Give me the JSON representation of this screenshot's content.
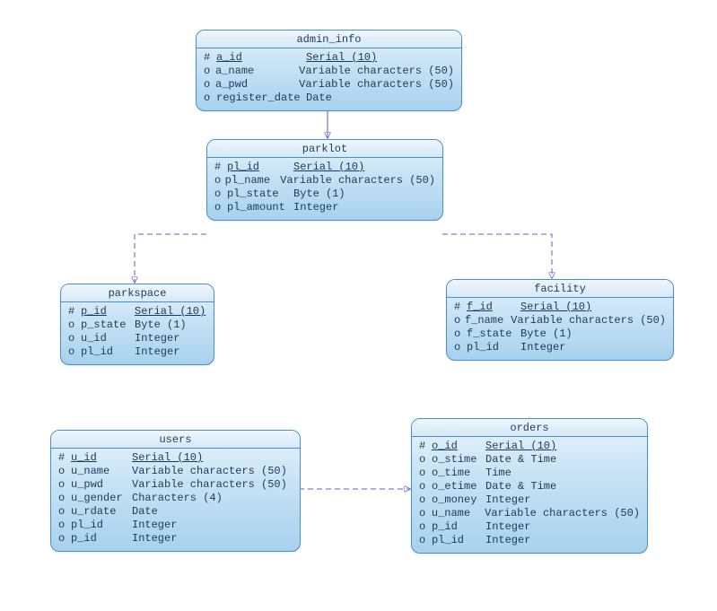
{
  "entities": {
    "admin_info": {
      "title": "admin_info",
      "fields": [
        {
          "sym": "#",
          "name": "a_id",
          "type": "Serial (10)",
          "pk": true
        },
        {
          "sym": "o",
          "name": "a_name",
          "type": "Variable characters (50)"
        },
        {
          "sym": "o",
          "name": "a_pwd",
          "type": "Variable characters (50)"
        },
        {
          "sym": "o",
          "name": "register_date",
          "type": "Date"
        }
      ]
    },
    "parklot": {
      "title": "parklot",
      "fields": [
        {
          "sym": "#",
          "name": "pl_id",
          "type": "Serial (10)",
          "pk": true
        },
        {
          "sym": "o",
          "name": "pl_name",
          "type": "Variable characters (50)"
        },
        {
          "sym": "o",
          "name": "pl_state",
          "type": "Byte (1)"
        },
        {
          "sym": "o",
          "name": "pl_amount",
          "type": "Integer"
        }
      ]
    },
    "parkspace": {
      "title": "parkspace",
      "fields": [
        {
          "sym": "#",
          "name": "p_id",
          "type": "Serial (10)",
          "pk": true
        },
        {
          "sym": "o",
          "name": "p_state",
          "type": "Byte (1)"
        },
        {
          "sym": "o",
          "name": "u_id",
          "type": "Integer"
        },
        {
          "sym": "o",
          "name": "pl_id",
          "type": "Integer"
        }
      ]
    },
    "facility": {
      "title": "facility",
      "fields": [
        {
          "sym": "#",
          "name": "f_id",
          "type": "Serial (10)",
          "pk": true
        },
        {
          "sym": "o",
          "name": "f_name",
          "type": "Variable characters (50)"
        },
        {
          "sym": "o",
          "name": "f_state",
          "type": "Byte (1)"
        },
        {
          "sym": "o",
          "name": "pl_id",
          "type": "Integer"
        }
      ]
    },
    "users": {
      "title": "users",
      "fields": [
        {
          "sym": "#",
          "name": "u_id",
          "type": "Serial (10)",
          "pk": true
        },
        {
          "sym": "o",
          "name": "u_name",
          "type": "Variable characters (50)"
        },
        {
          "sym": "o",
          "name": "u_pwd",
          "type": "Variable characters (50)"
        },
        {
          "sym": "o",
          "name": "u_gender",
          "type": "Characters (4)"
        },
        {
          "sym": "o",
          "name": "u_rdate",
          "type": "Date"
        },
        {
          "sym": "o",
          "name": "pl_id",
          "type": "Integer"
        },
        {
          "sym": "o",
          "name": "p_id",
          "type": "Integer"
        }
      ]
    },
    "orders": {
      "title": "orders",
      "fields": [
        {
          "sym": "#",
          "name": "o_id",
          "type": "Serial (10)",
          "pk": true
        },
        {
          "sym": "o",
          "name": "o_stime",
          "type": "Date & Time"
        },
        {
          "sym": "o",
          "name": "o_time",
          "type": "Time"
        },
        {
          "sym": "o",
          "name": "o_etime",
          "type": "Date & Time"
        },
        {
          "sym": "o",
          "name": "o_money",
          "type": "Integer"
        },
        {
          "sym": "o",
          "name": "u_name",
          "type": "Variable characters (50)"
        },
        {
          "sym": "o",
          "name": "p_id",
          "type": "Integer"
        },
        {
          "sym": "o",
          "name": "pl_id",
          "type": "Integer"
        }
      ]
    }
  },
  "relationships": [
    {
      "from": "admin_info",
      "to": "parklot",
      "style": "solid"
    },
    {
      "from": "parklot",
      "to": "parkspace",
      "style": "dashed"
    },
    {
      "from": "parklot",
      "to": "facility",
      "style": "dashed"
    },
    {
      "from": "users",
      "to": "orders",
      "style": "dashed"
    }
  ]
}
